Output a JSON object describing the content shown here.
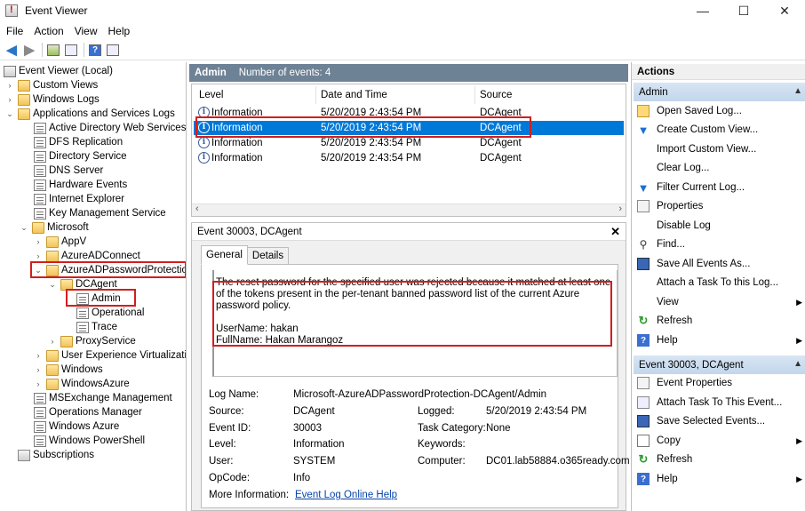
{
  "window": {
    "title": "Event Viewer",
    "minimize": "—",
    "maximize": "☐",
    "close": "✕"
  },
  "menu": [
    "File",
    "Action",
    "View",
    "Help"
  ],
  "tree": {
    "root": "Event Viewer (Local)",
    "custom_views": "Custom Views",
    "windows_logs": "Windows Logs",
    "app_services": "Applications and Services Logs",
    "items": [
      "Active Directory Web Services",
      "DFS Replication",
      "Directory Service",
      "DNS Server",
      "Hardware Events",
      "Internet Explorer",
      "Key Management Service"
    ],
    "microsoft": "Microsoft",
    "appv": "AppV",
    "azureadconnect": "AzureADConnect",
    "azureadpasswordprotection": "AzureADPasswordProtection",
    "dcagent": "DCAgent",
    "admin": "Admin",
    "operational": "Operational",
    "trace": "Trace",
    "proxyservice": "ProxyService",
    "uev": "User Experience Virtualization",
    "windows": "Windows",
    "windowsazure": "WindowsAzure",
    "after": [
      "MSExchange Management",
      "Operations Manager",
      "Windows Azure",
      "Windows PowerShell"
    ],
    "subscriptions": "Subscriptions"
  },
  "events_header": {
    "name": "Admin",
    "count": "Number of events: 4"
  },
  "columns": [
    "Level",
    "Date and Time",
    "Source"
  ],
  "events": [
    {
      "level": "Information",
      "datetime": "5/20/2019 2:43:54 PM",
      "source": "DCAgent"
    },
    {
      "level": "Information",
      "datetime": "5/20/2019 2:43:54 PM",
      "source": "DCAgent"
    },
    {
      "level": "Information",
      "datetime": "5/20/2019 2:43:54 PM",
      "source": "DCAgent"
    },
    {
      "level": "Information",
      "datetime": "5/20/2019 2:43:54 PM",
      "source": "DCAgent"
    }
  ],
  "detail": {
    "title": "Event 30003, DCAgent",
    "tabs": [
      "General",
      "Details"
    ],
    "message": "The reset password for the specified user was rejected because it matched at least one of the tokens present in the per-tenant banned password list of the current Azure password policy.",
    "username": "UserName: hakan",
    "fullname": "FullName: Hakan Marangoz",
    "props": {
      "log_name_k": "Log Name:",
      "log_name_v": "Microsoft-AzureADPasswordProtection-DCAgent/Admin",
      "source_k": "Source:",
      "source_v": "DCAgent",
      "logged_k": "Logged:",
      "logged_v": "5/20/2019 2:43:54 PM",
      "event_id_k": "Event ID:",
      "event_id_v": "30003",
      "task_k": "Task Category:",
      "task_v": "None",
      "level_k": "Level:",
      "level_v": "Information",
      "keywords_k": "Keywords:",
      "user_k": "User:",
      "user_v": "SYSTEM",
      "computer_k": "Computer:",
      "computer_v": "DC01.lab58884.o365ready.com",
      "opcode_k": "OpCode:",
      "opcode_v": "Info",
      "more_k": "More Information:",
      "more_v": "Event Log Online Help"
    }
  },
  "actions": {
    "title": "Actions",
    "section1": "Admin",
    "items1": [
      "Open Saved Log...",
      "Create Custom View...",
      "Import Custom View...",
      "Clear Log...",
      "Filter Current Log...",
      "Properties",
      "Disable Log",
      "Find...",
      "Save All Events As...",
      "Attach a Task To this Log...",
      "View",
      "Refresh",
      "Help"
    ],
    "section2": "Event 30003, DCAgent",
    "items2": [
      "Event Properties",
      "Attach Task To This Event...",
      "Save Selected Events...",
      "Copy",
      "Refresh",
      "Help"
    ]
  }
}
